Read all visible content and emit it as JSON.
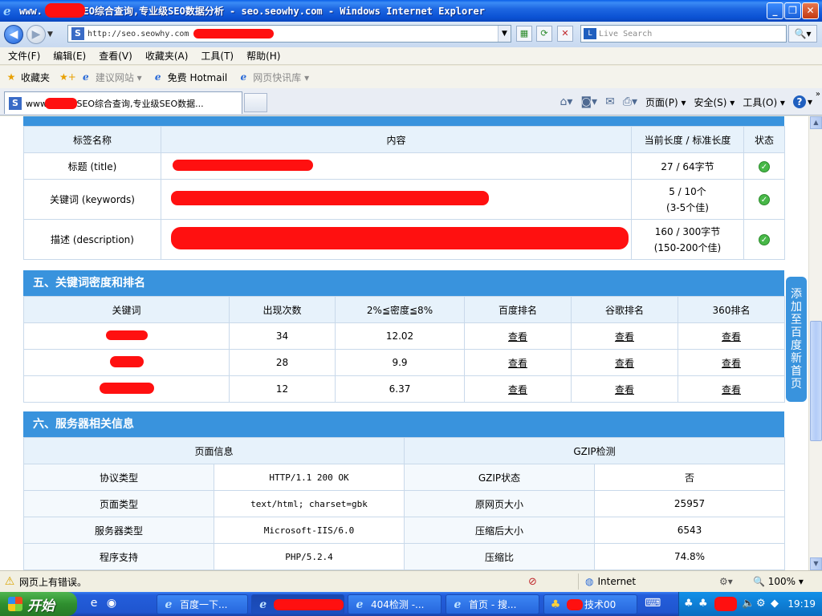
{
  "window": {
    "title": "www.        .com,SEO综合查询,专业级SEO数据分析 - seo.seowhy.com - Windows Internet Explorer",
    "minimize": "_",
    "restore": "❐",
    "close": "✕"
  },
  "address": {
    "url": "http://seo.seowhy.com",
    "search_placeholder": "Live Search",
    "search_engine_icon": "live-search-icon"
  },
  "menu": [
    "文件(F)",
    "编辑(E)",
    "查看(V)",
    "收藏夹(A)",
    "工具(T)",
    "帮助(H)"
  ],
  "favorites": {
    "label": "收藏夹",
    "items": [
      "建议网站 ▾",
      "免费 Hotmail",
      "网页快讯库 ▾"
    ]
  },
  "tab": {
    "label": "www.        .com,SEO综合查询,专业级SEO数据..."
  },
  "command_bar": {
    "page": "页面(P) ▾",
    "safety": "安全(S) ▾",
    "tools": "工具(O) ▾",
    "help": "?"
  },
  "meta_table": {
    "headers": [
      "标签名称",
      "内容",
      "当前长度 / 标准长度",
      "状态"
    ],
    "rows": [
      {
        "name": "标题 (title)",
        "length": "27 / 64字节",
        "length2": ""
      },
      {
        "name": "关键词 (keywords)",
        "length": "5 / 10个",
        "length2": "(3-5个佳)"
      },
      {
        "name": "描述 (description)",
        "length": "160 / 300字节",
        "length2": "(150-200个佳)"
      }
    ]
  },
  "keywords_section": {
    "title": "五、关键词密度和排名",
    "headers": [
      "关键词",
      "出现次数",
      "2%≦密度≦8%",
      "百度排名",
      "谷歌排名",
      "360排名"
    ],
    "rows": [
      {
        "count": "34",
        "density": "12.02",
        "baidu": "查看",
        "google": "查看",
        "s360": "查看"
      },
      {
        "count": "28",
        "density": "9.9",
        "baidu": "查看",
        "google": "查看",
        "s360": "查看"
      },
      {
        "count": "12",
        "density": "6.37",
        "baidu": "查看",
        "google": "查看",
        "s360": "查看"
      }
    ]
  },
  "server_section": {
    "title": "六、服务器相关信息",
    "left_header": "页面信息",
    "right_header": "GZIP检测",
    "rows": [
      {
        "k1": "协议类型",
        "v1": "HTTP/1.1 200 OK",
        "k2": "GZIP状态",
        "v2": "否"
      },
      {
        "k1": "页面类型",
        "v1": "text/html; charset=gbk",
        "k2": "原网页大小",
        "v2": "25957"
      },
      {
        "k1": "服务器类型",
        "v1": "Microsoft-IIS/6.0",
        "k2": "压缩后大小",
        "v2": "6543"
      },
      {
        "k1": "程序支持",
        "v1": "PHP/5.2.4",
        "k2": "压缩比",
        "v2": "74.8%"
      }
    ]
  },
  "side_tab": "添加至百度新首页",
  "status": {
    "message": "网页上有错误。",
    "zone": "Internet",
    "zoom": "100%"
  },
  "taskbar": {
    "start": "开始",
    "buttons": [
      "百度一下...",
      "",
      "404检测 -...",
      "首页 - 搜...",
      "技术00"
    ],
    "clock": "19:19"
  }
}
